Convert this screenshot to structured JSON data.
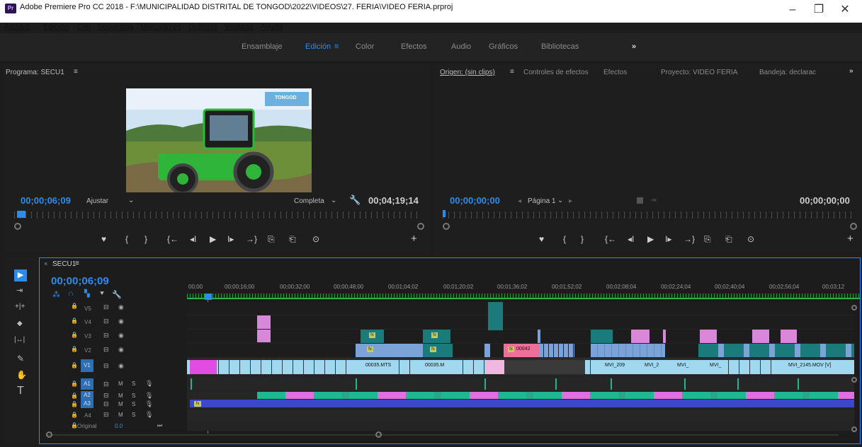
{
  "titlebar": {
    "icon": "Pr",
    "title": "Adobe Premiere Pro CC 2018 - F:\\MUNICIPALIDAD DISTRITAL DE TONGOD\\2022\\VIDEOS\\27.  FERIA\\VIDEO FERIA.prproj",
    "minimize": "–",
    "restore": "❐",
    "close": "✕"
  },
  "menu": [
    "Archivo",
    "Edición",
    "Clip",
    "Secuencia",
    "Marcadores",
    "Gráficos",
    "Ventana",
    "Ayuda"
  ],
  "workspaces": {
    "items": [
      "Ensamblaje",
      "Edición",
      "Color",
      "Efectos",
      "Audio",
      "Gráficos",
      "Bibliotecas"
    ],
    "active": "Edición",
    "more": "»",
    "menu_glyph": "≡"
  },
  "program": {
    "title": "Programa: SECU1",
    "menu_glyph": "≡",
    "timecode": "00;00;06;09",
    "fit": "Ajustar",
    "quality": "Completa",
    "duration": "00;04;19;14"
  },
  "source": {
    "tabs": [
      "Origen: (sin clips)",
      "Controles de efectos",
      "Efectos",
      "Proyecto: VIDEO FERIA",
      "Bandeja: declarac"
    ],
    "menu_glyph": "≡",
    "more": "»",
    "timecode": "00;00;00;00",
    "page": "Página 1",
    "duration": "00;00;00;00"
  },
  "transport": [
    "♥",
    "{",
    "}",
    "{←",
    "◂I",
    "▶",
    "I▸",
    "→}",
    "⎘",
    "⎗",
    "⊙",
    "+"
  ],
  "tools": [
    "▶",
    "⇥",
    "+|+",
    "◆",
    "|↔|",
    "✎",
    "✋",
    "T"
  ],
  "timeline": {
    "sequence": "SECU1",
    "close": "×",
    "menu_glyph": "≡",
    "timecode": "00;00;06;09",
    "ticks": [
      "00;00",
      "00;00;16;00",
      "00;00;32;00",
      "00;00;48;00",
      "00;01;04;02",
      "00;01;20;02",
      "00;01;36;02",
      "00;01;52;02",
      "00;02;08;04",
      "00;02;24;04",
      "00;02;40;04",
      "00;02;56;04",
      "00;03;12"
    ],
    "video_tracks": [
      "V5",
      "V4",
      "V3",
      "V2",
      "V1"
    ],
    "audio_tracks": [
      "A1",
      "A2",
      "A3",
      "A4"
    ],
    "mute": "M",
    "solo": "S",
    "original_label": "Original",
    "original_value": "0.0",
    "clip_labels": [
      "00035.MTS",
      "00035.M",
      "00042",
      "MVI_209",
      "MVI_2",
      "MVI_",
      "MVI_",
      "MVI_2145.MOV [V]"
    ],
    "fx_label": "fx"
  },
  "thumbnail": {
    "logo_text": "TONGOD"
  },
  "colors": {
    "accent": "#2d8ceb",
    "teal_clip": "#1b7a7a",
    "pink_clip": "#d987d9",
    "v1_clip": "#9fd8ef",
    "audio_green": "#1fb894",
    "audio_blue": "#3b49c8"
  }
}
